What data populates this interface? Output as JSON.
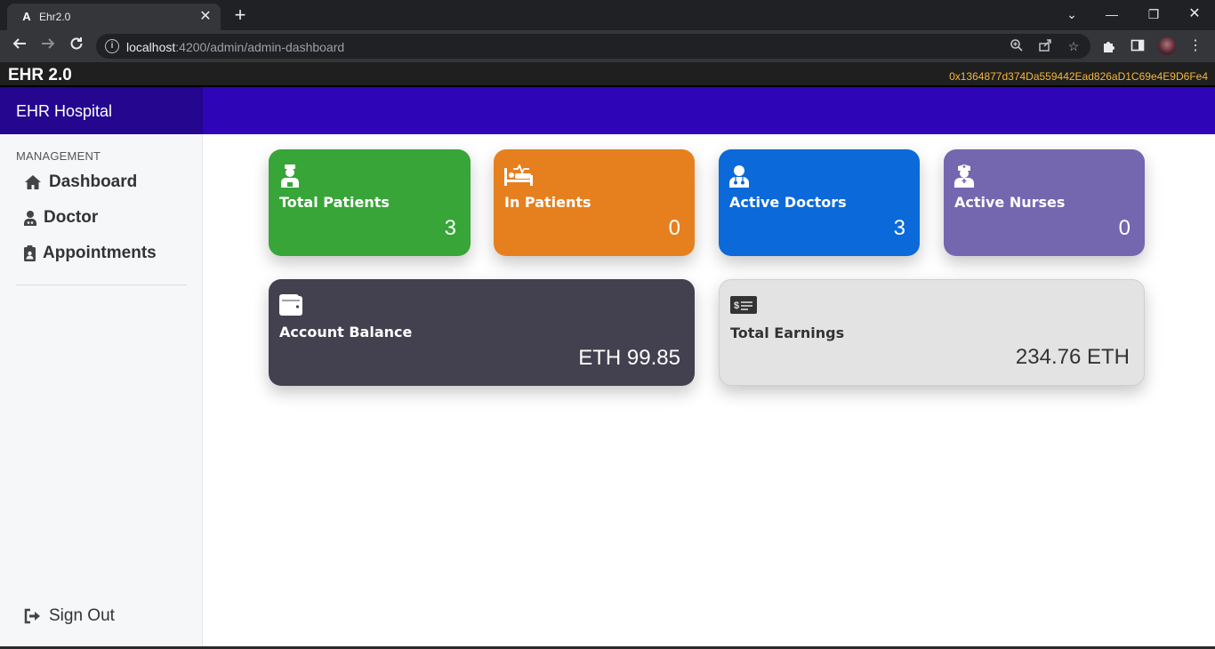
{
  "browser": {
    "tab_title": "Ehr2.0",
    "tab_favicon": "A",
    "url_host": "localhost",
    "url_rest": ":4200/admin/admin-dashboard"
  },
  "app": {
    "brand": "EHR 2.0",
    "wallet_address": "0x1364877d374Da559442Ead826aD1C69e4E9D6Fe4",
    "hospital_name": "EHR Hospital"
  },
  "sidebar": {
    "heading": "MANAGEMENT",
    "items": [
      {
        "label": "Dashboard",
        "icon": "home-icon"
      },
      {
        "label": "Doctor",
        "icon": "user-doctor-icon"
      },
      {
        "label": "Appointments",
        "icon": "clipboard-user-icon"
      }
    ],
    "sign_out": "Sign Out"
  },
  "cards": [
    {
      "label": "Total Patients",
      "value": "3",
      "icon": "hospital-user-icon",
      "color": "#37a537"
    },
    {
      "label": "In Patients",
      "value": "0",
      "icon": "bed-pulse-icon",
      "color": "#e6801f"
    },
    {
      "label": "Active Doctors",
      "value": "3",
      "icon": "user-doctor-icon",
      "color": "#0b69d9"
    },
    {
      "label": "Active Nurses",
      "value": "0",
      "icon": "user-nurse-icon",
      "color": "#7467b0"
    },
    {
      "label": "Account Balance",
      "value": "ETH 99.85",
      "icon": "wallet-icon",
      "color": "#43414f"
    },
    {
      "label": "Total Earnings",
      "value": "234.76 ETH",
      "icon": "money-check-dollar-icon",
      "color": "#e3e3e3"
    }
  ]
}
